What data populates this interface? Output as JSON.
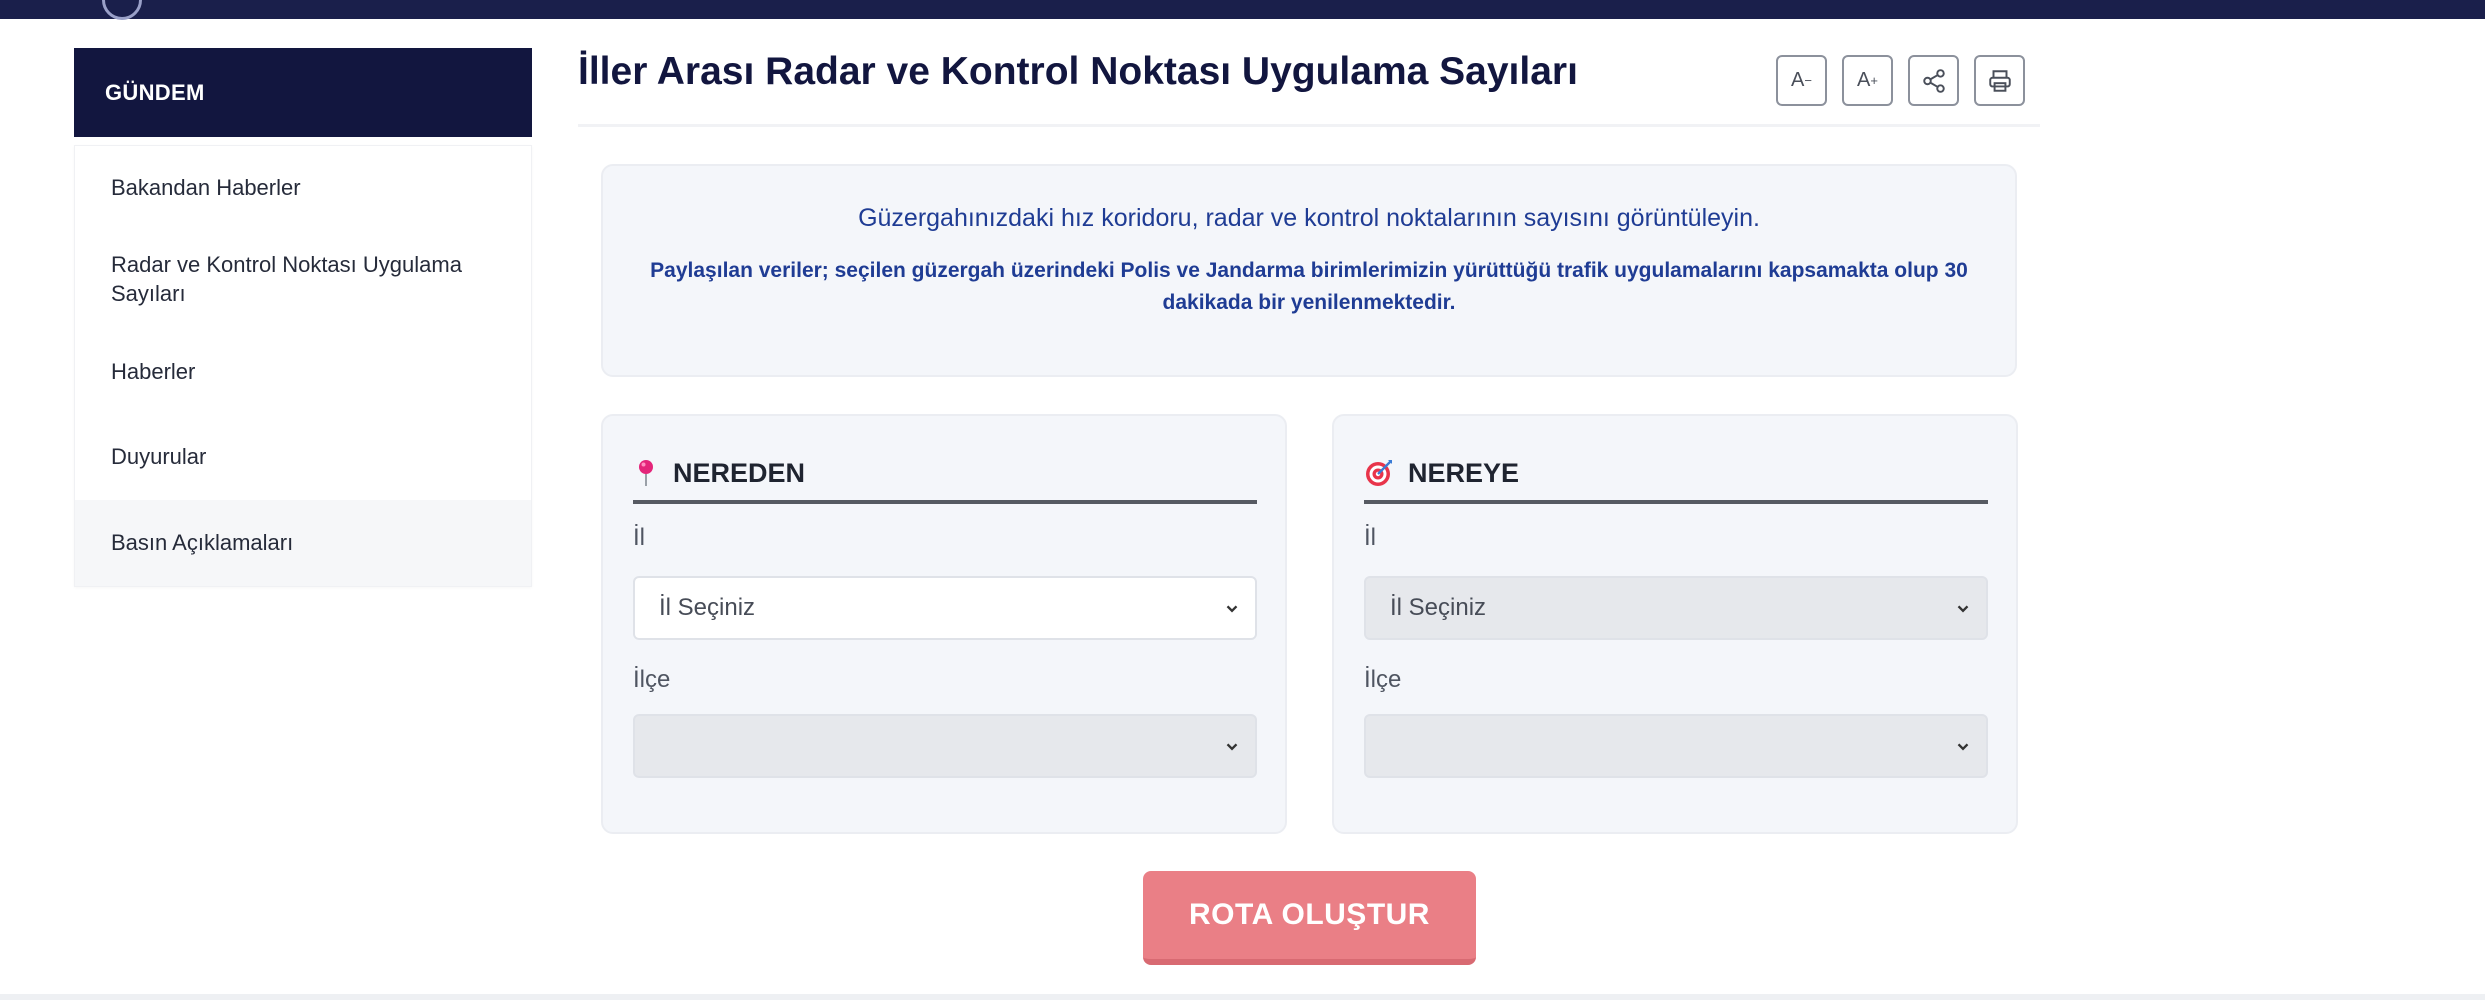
{
  "sidebar": {
    "heading": "GÜNDEM",
    "items": [
      {
        "label": "Bakandan Haberler"
      },
      {
        "label": "Radar ve Kontrol Noktası Uygulama Sayıları"
      },
      {
        "label": "Haberler"
      },
      {
        "label": "Duyurular"
      },
      {
        "label": "Basın Açıklamaları"
      }
    ]
  },
  "page": {
    "title": "İller Arası Radar ve Kontrol Noktası Uygulama Sayıları",
    "tools": {
      "decrease_font": "A",
      "decrease_sup": "−",
      "increase_font": "A",
      "increase_sup": "+",
      "share_icon": "share-icon",
      "print_icon": "print-icon"
    }
  },
  "info": {
    "line1": "Güzergahınızdaki hız koridoru, radar ve kontrol noktalarının sayısını görüntüleyin.",
    "line2": "Paylaşılan veriler; seçilen güzergah üzerindeki Polis ve Jandarma birimlerimizin yürüttüğü trafik uygulamalarını kapsamakta olup 30 dakikada bir yenilenmektedir."
  },
  "from_panel": {
    "title": "NEREDEN",
    "icon": "pushpin-icon",
    "il_label": "İl",
    "il_value": "İl Seçiniz",
    "ilce_label": "İlçe",
    "ilce_value": ""
  },
  "to_panel": {
    "title": "NEREYE",
    "icon": "target-icon",
    "il_label": "İl",
    "il_value": "İl Seçiniz",
    "ilce_label": "İlçe",
    "ilce_value": ""
  },
  "actions": {
    "route_button": "ROTA OLUŞTUR"
  },
  "colors": {
    "navy": "#12163f",
    "accent_blue": "#1f3c94",
    "button_red": "#ea7f86"
  }
}
